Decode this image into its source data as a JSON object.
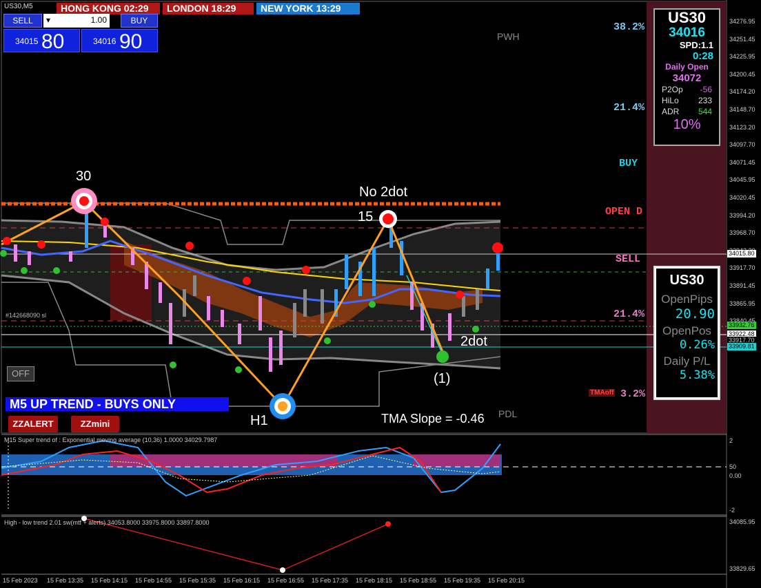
{
  "symbol": "US30,M5",
  "clocks": [
    {
      "label": "HONG KONG 02:29",
      "color": "#b01818"
    },
    {
      "label": "LONDON   18:29",
      "color": "#b01818"
    },
    {
      "label": "NEW YORK 13:29",
      "color": "#1a7ad0"
    }
  ],
  "trade": {
    "sell_label": "SELL",
    "buy_label": "BUY",
    "lot": "1.00",
    "sell_small": "34015",
    "sell_big": "80",
    "buy_small": "34016",
    "buy_big": "90"
  },
  "fib_levels": [
    "38.2%",
    "21.4%",
    "21.4%",
    "3.2%"
  ],
  "signals": {
    "buy": "BUY",
    "open_d": "OPEN D",
    "sell": "SELL",
    "pwh": "PWH",
    "pdl": "PDL",
    "tmaoff": "TMAoff"
  },
  "annotations": {
    "n30": "30",
    "no2dot": "No 2dot",
    "n15": "15",
    "h1": "H1",
    "twodot": "2dot",
    "paren1": "(1)",
    "tma_slope": "TMA Slope = -0.46",
    "order_tag": "#142668090 sl"
  },
  "trend_banner": "M5 UP TREND - BUYS ONLY",
  "buttons": {
    "off": "OFF",
    "zzalert": "ZZALERT",
    "zzmini": "ZZmini"
  },
  "info_top": {
    "symbol": "US30",
    "price": "34016",
    "spd": "SPD:1.1",
    "timer": "0:28",
    "daily_open_label": "Daily Open",
    "daily_open": "34072",
    "rows": [
      {
        "k": "P2Op",
        "v": "-56",
        "c": "#e060e0"
      },
      {
        "k": "HiLo",
        "v": "233",
        "c": "#dddddd"
      },
      {
        "k": "ADR",
        "v": "544",
        "c": "#40e040"
      }
    ],
    "pct": "10%"
  },
  "info_bottom": {
    "symbol": "US30",
    "open_pips_label": "OpenPips",
    "open_pips": "20.90",
    "open_pos_label": "OpenPos",
    "open_pos": "0.26%",
    "daily_pl_label": "Daily P/L",
    "daily_pl": "5.38%"
  },
  "price_axis": [
    "34276.95",
    "34251.45",
    "34225.95",
    "34200.45",
    "34174.20",
    "34148.70",
    "34123.20",
    "34097.70",
    "34071.45",
    "34045.95",
    "34020.45",
    "33994.20",
    "33968.70",
    "33943.20",
    "33917.70",
    "33891.45",
    "33865.95",
    "33840.45",
    "33814.95"
  ],
  "price_tags": [
    {
      "label": "34015.80",
      "bg": "#ffffff",
      "c": "#000000"
    },
    {
      "label": "33932.76",
      "bg": "#30d030",
      "c": "#000000"
    },
    {
      "label": "33922.48",
      "bg": "#ffffff",
      "c": "#000000"
    },
    {
      "label": "33917.70",
      "bg": "#000000",
      "c": "#cccccc"
    },
    {
      "label": "33909.81",
      "bg": "#20d0d0",
      "c": "#000000"
    }
  ],
  "ind1": {
    "title": "M15  Super trend of : Exponential moving average (10,36)  1.0000 34029.7987",
    "axis": [
      "2",
      "50",
      "0.00",
      "-2"
    ]
  },
  "ind2": {
    "title": "High - low trend 2.01 sw(mtf + alerts) 34053.8000 33975.8000 33897.8000",
    "axis": [
      "34085.95",
      "33829.65"
    ]
  },
  "time_axis": [
    "15 Feb 2023",
    "15 Feb 13:35",
    "15 Feb 14:15",
    "15 Feb 14:55",
    "15 Feb 15:35",
    "15 Feb 16:15",
    "15 Feb 16:55",
    "15 Feb 17:35",
    "15 Feb 18:15",
    "15 Feb 18:55",
    "15 Feb 19:35",
    "15 Feb 20:15"
  ]
}
